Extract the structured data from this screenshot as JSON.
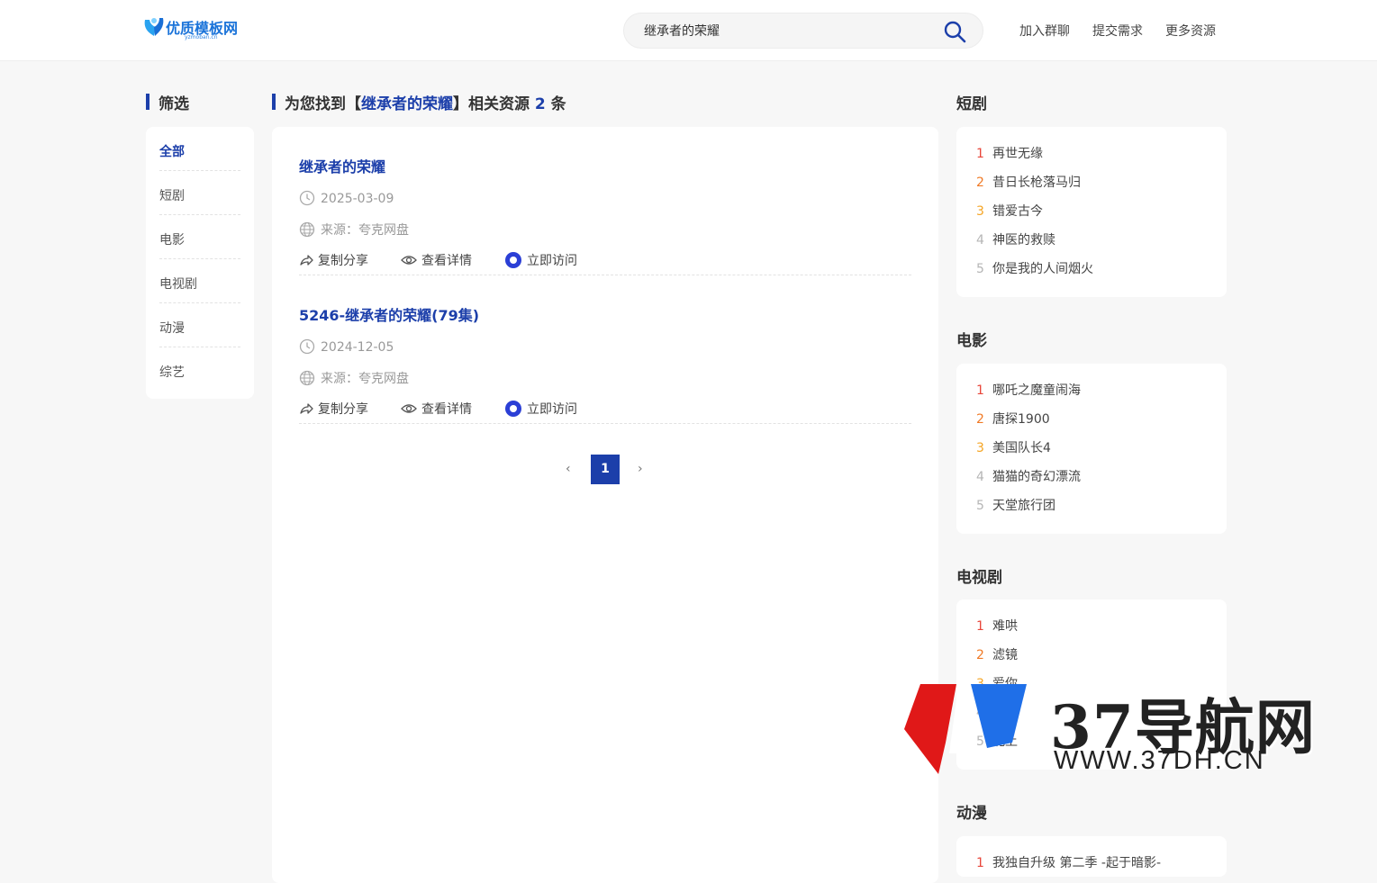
{
  "header": {
    "logo_text": "优质模板网",
    "logo_sub": "yzmoban.cn",
    "search_value": "继承者的荣耀",
    "nav": [
      "加入群聊",
      "提交需求",
      "更多资源"
    ]
  },
  "filter": {
    "title": "筛选",
    "items": [
      "全部",
      "短剧",
      "电影",
      "电视剧",
      "动漫",
      "综艺"
    ]
  },
  "results": {
    "heading_prefix": "为您找到【",
    "heading_keyword": "继承者的荣耀",
    "heading_middle": "】相关资源 ",
    "heading_count": "2",
    "heading_suffix": " 条",
    "items": [
      {
        "title": "继承者的荣耀",
        "date": "2025-03-09",
        "source": "来源：夸克网盘",
        "share": "复制分享",
        "detail": "查看详情",
        "visit": "立即访问"
      },
      {
        "title": "5246-继承者的荣耀(79集)",
        "date": "2024-12-05",
        "source": "来源：夸克网盘",
        "share": "复制分享",
        "detail": "查看详情",
        "visit": "立即访问"
      }
    ],
    "pagination": {
      "prev": "‹",
      "current": "1",
      "next": "›"
    }
  },
  "ranks": [
    {
      "title": "短剧",
      "items": [
        "再世无缘",
        "昔日长枪落马归",
        "错爱古今",
        "神医的救赎",
        "你是我的人间烟火"
      ]
    },
    {
      "title": "电影",
      "items": [
        "哪吒之魔童闹海",
        "唐探1900",
        "美国队长4",
        "猫猫的奇幻漂流",
        "天堂旅行团"
      ]
    },
    {
      "title": "电视剧",
      "items": [
        "难哄",
        "滤镜",
        "爱你",
        "",
        "北上"
      ]
    },
    {
      "title": "动漫",
      "items": [
        "我独自升级 第二季 -起于暗影-"
      ]
    }
  ],
  "rank_numbers": [
    "1",
    "2",
    "3",
    "4",
    "5"
  ],
  "watermark": {
    "text": "37导航网",
    "url": "WWW.37DH.CN"
  },
  "colors": {
    "accent": "#1c3faa",
    "rank1": "#e8463a",
    "rank2": "#f07a26",
    "rank3": "#f5a524"
  }
}
